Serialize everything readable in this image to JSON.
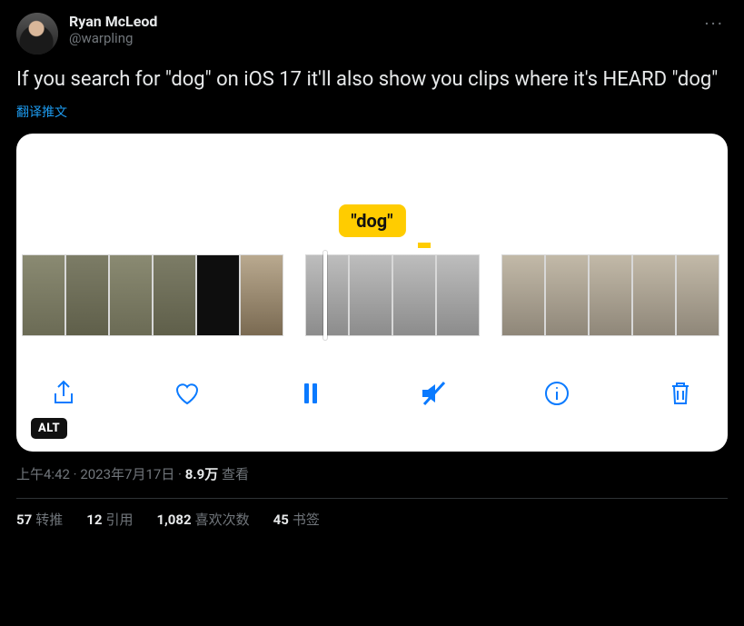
{
  "author": {
    "display_name": "Ryan McLeod",
    "handle": "@warpling"
  },
  "tweet_text": "If you search for \"dog\" on iOS 17 it'll also show you clips where it's HEARD \"dog\"",
  "translate_label": "翻译推文",
  "media": {
    "search_term_label": "\"dog\"",
    "alt_badge": "ALT",
    "toolbar_icons": {
      "share": "share-icon",
      "like": "heart-icon",
      "pause": "pause-icon",
      "mute": "mute-icon",
      "info": "info-icon",
      "trash": "trash-icon"
    }
  },
  "meta": {
    "time": "上午4:42",
    "date": "2023年7月17日",
    "views_count": "8.9万",
    "views_label": "查看"
  },
  "stats": {
    "retweets": {
      "count": "57",
      "label": "转推"
    },
    "quotes": {
      "count": "12",
      "label": "引用"
    },
    "likes": {
      "count": "1,082",
      "label": "喜欢次数"
    },
    "bookmarks": {
      "count": "45",
      "label": "书签"
    }
  }
}
